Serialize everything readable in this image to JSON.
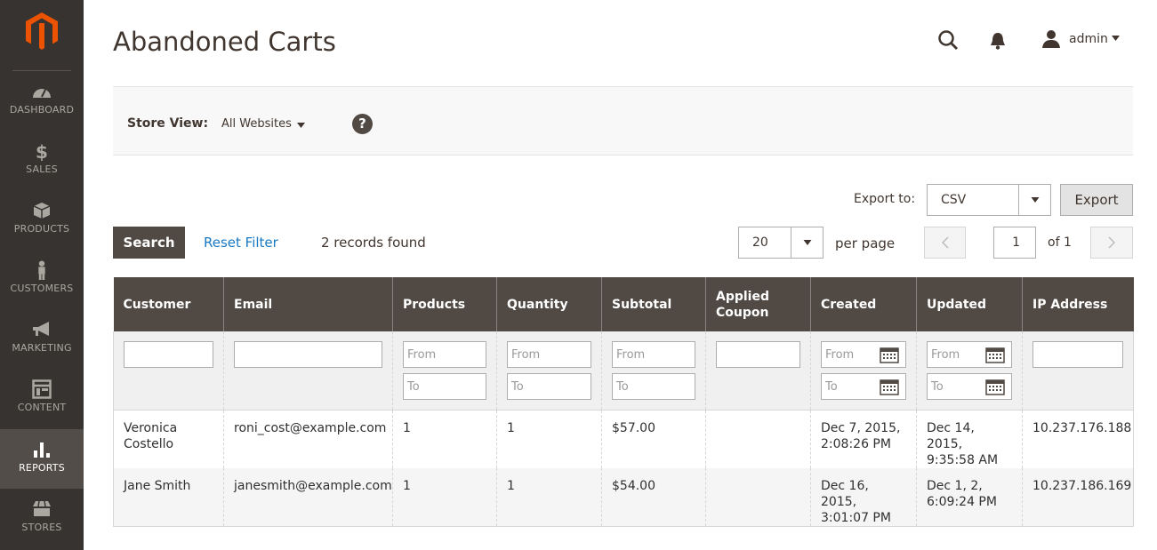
{
  "colors": {
    "sidebar": "#373330",
    "accent": "#eb5202",
    "header_bg": "#514943",
    "link": "#1979c3"
  },
  "sidebar": {
    "items": [
      {
        "label": "DASHBOARD",
        "icon": "dashboard-icon"
      },
      {
        "label": "SALES",
        "icon": "dollar-icon"
      },
      {
        "label": "PRODUCTS",
        "icon": "box-icon"
      },
      {
        "label": "CUSTOMERS",
        "icon": "person-icon"
      },
      {
        "label": "MARKETING",
        "icon": "megaphone-icon"
      },
      {
        "label": "CONTENT",
        "icon": "layout-icon"
      },
      {
        "label": "REPORTS",
        "icon": "bar-chart-icon",
        "active": true
      },
      {
        "label": "STORES",
        "icon": "store-icon"
      }
    ]
  },
  "header": {
    "title": "Abandoned Carts",
    "user": "admin"
  },
  "store_view": {
    "label": "Store View:",
    "value": "All Websites"
  },
  "export": {
    "label": "Export to:",
    "format": "CSV",
    "button": "Export"
  },
  "toolbar": {
    "search": "Search",
    "reset": "Reset Filter",
    "records": "2 records found"
  },
  "pager": {
    "per_page": "20",
    "per_page_label": "per page",
    "page": "1",
    "of": "of 1"
  },
  "grid": {
    "columns": [
      "Customer",
      "Email",
      "Products",
      "Quantity",
      "Subtotal",
      "Applied Coupon",
      "Created",
      "Updated",
      "IP Address"
    ],
    "filters": {
      "from": "From",
      "to": "To"
    },
    "rows": [
      {
        "customer": "Veronica Costello",
        "email": "roni_cost@example.com",
        "products": "1",
        "quantity": "1",
        "subtotal": "$57.00",
        "coupon": "",
        "created": "Dec 7, 2015, 2:08:26 PM",
        "updated": "Dec 14, 2015, 9:35:58 AM",
        "ip": "10.237.176.188"
      },
      {
        "customer": "Jane Smith",
        "email": "janesmith@example.com",
        "products": "1",
        "quantity": "1",
        "subtotal": "$54.00",
        "coupon": "",
        "created": "Dec 16, 2015, 3:01:07 PM",
        "updated": "Dec 1, 2, 6:09:24 PM",
        "ip": "10.237.186.169"
      }
    ]
  }
}
